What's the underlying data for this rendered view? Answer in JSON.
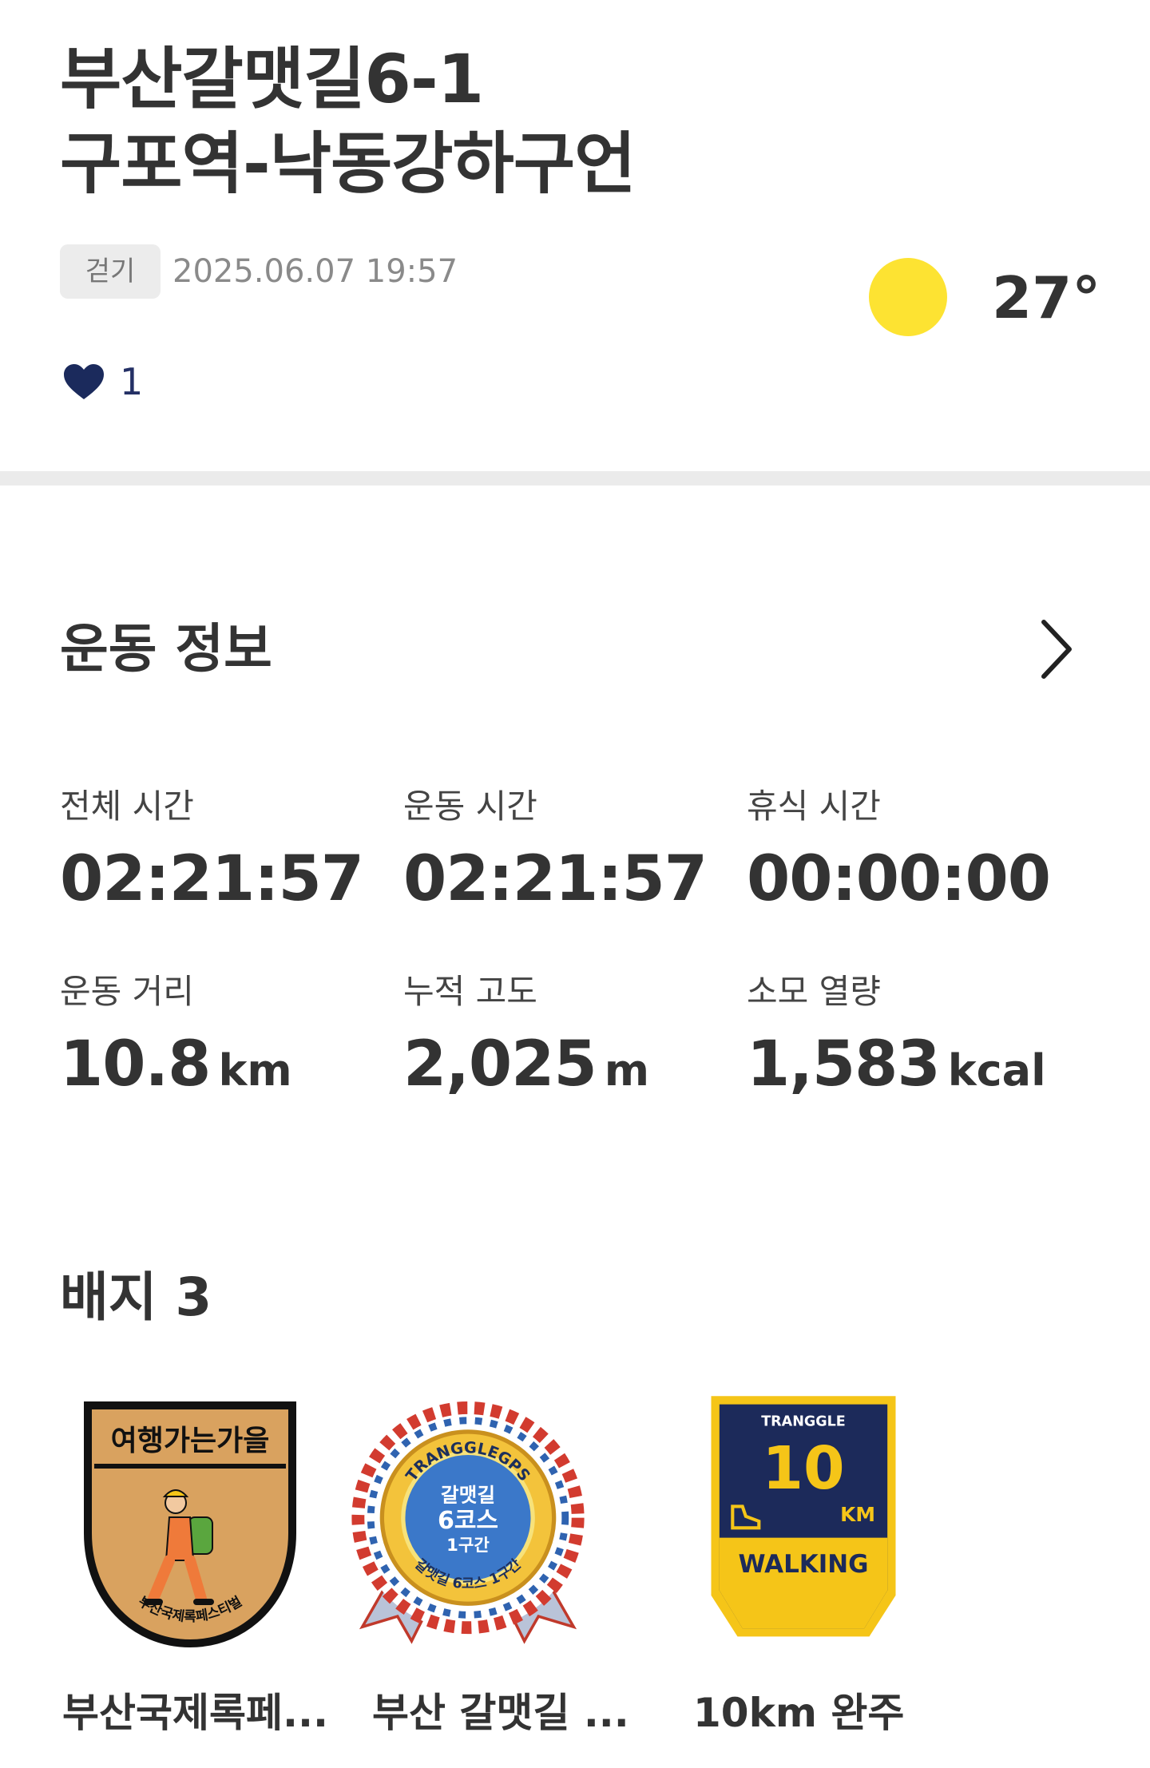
{
  "header": {
    "title_line1": "부산갈맷길6-1",
    "title_line2": "구포역-낙동강하구언",
    "activity_type": "걷기",
    "datetime": "2025.06.07 19:57",
    "like_count": "1",
    "weather": {
      "icon": "sun-icon",
      "temperature": "27°",
      "sun_color": "#fde332"
    }
  },
  "exercise_info": {
    "title": "운동 정보",
    "stats": [
      {
        "label": "전체 시간",
        "value": "02:21:57",
        "unit": ""
      },
      {
        "label": "운동 시간",
        "value": "02:21:57",
        "unit": ""
      },
      {
        "label": "휴식 시간",
        "value": "00:00:00",
        "unit": ""
      },
      {
        "label": "운동 거리",
        "value": "10.8",
        "unit": "km"
      },
      {
        "label": "누적 고도",
        "value": "2,025",
        "unit": "m"
      },
      {
        "label": "소모 열량",
        "value": "1,583",
        "unit": "kcal"
      }
    ]
  },
  "badges": {
    "title": "배지 3",
    "items": [
      {
        "name": "부산국제록페...",
        "icon": "festival-shield-badge-icon",
        "top_text": "여행가는가을",
        "arc_text": "부산국제록페스티벌"
      },
      {
        "name": "부산 갈맷길 ...",
        "icon": "ribbon-rosette-badge-icon",
        "ring_text": "TRANGGLEGPS",
        "center_line1": "갈맷길",
        "center_line2": "6코스",
        "center_line3": "1구간",
        "bottom_arc": "갈맷길 6코스 1구간"
      },
      {
        "name": "10km 완주",
        "icon": "walking-10km-badge-icon",
        "brand": "TRANGGLE",
        "number": "10",
        "unit": "KM",
        "label": "WALKING"
      }
    ]
  },
  "colors": {
    "text": "#333333",
    "muted": "#8a8a8a",
    "heart": "#1b2a5c",
    "divider": "#ebebeb"
  }
}
